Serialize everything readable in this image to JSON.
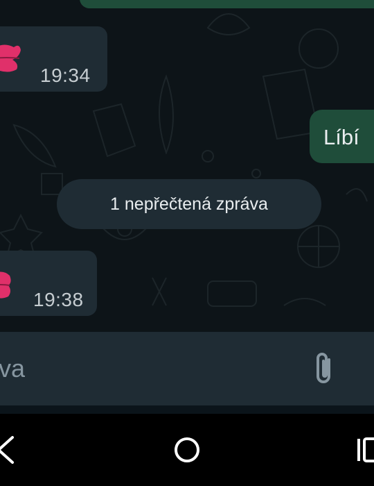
{
  "chat": {
    "messages": [
      {
        "direction": "incoming",
        "content": "kiss-lips-emoji",
        "time": "19:34"
      },
      {
        "direction": "outgoing",
        "text": "Líbí"
      },
      {
        "direction": "incoming",
        "content": "kiss-lips-emoji",
        "time": "19:38"
      }
    ],
    "unread_divider": "1 nepřečtená zpráva"
  },
  "input": {
    "placeholder_visible": "va",
    "attach_icon": "paperclip-icon"
  },
  "navigation": {
    "back_icon": "chevron-left-icon",
    "home_icon": "circle-home-icon",
    "recents_icon": "recents-icon"
  },
  "colors": {
    "chat_background": "#0d1418",
    "incoming_bubble": "#1f2c34",
    "outgoing_bubble": "#1f4d3a",
    "input_bar": "#1f2c34",
    "nav_bar": "#000000",
    "lips": "#e0306a"
  }
}
